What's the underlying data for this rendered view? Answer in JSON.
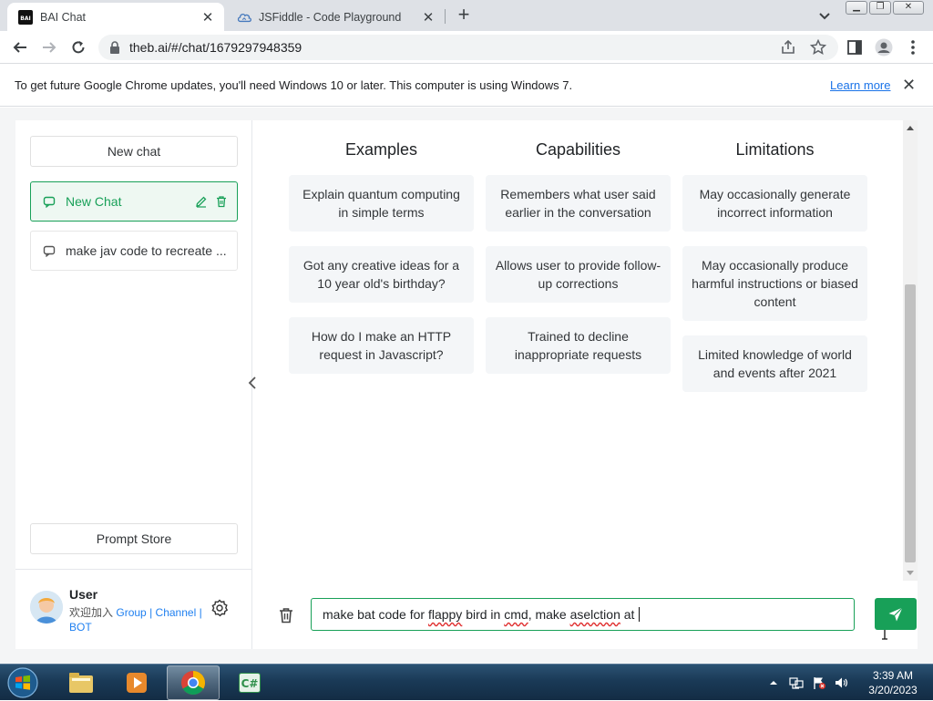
{
  "browser": {
    "tabs": [
      {
        "title": "BAI Chat",
        "favicon": "bai-logo"
      },
      {
        "title": "JSFiddle - Code Playground",
        "favicon": "jsfiddle-cloud-icon"
      }
    ],
    "url": "theb.ai/#/chat/1679297948359",
    "infobar": {
      "message": "To get future Google Chrome updates, you'll need Windows 10 or later. This computer is using Windows 7.",
      "link": "Learn more"
    }
  },
  "sidebar": {
    "new_chat_button": "New chat",
    "chats": [
      {
        "label": "New Chat",
        "active": true
      },
      {
        "label": "make jav code to recreate ...",
        "active": false
      }
    ],
    "prompt_store_button": "Prompt Store",
    "user": {
      "name": "User",
      "join_text": "欢迎加入",
      "links": [
        "Group",
        "Channel",
        "BOT"
      ],
      "separator": "|"
    }
  },
  "main": {
    "columns": [
      {
        "heading": "Examples",
        "cards": [
          "Explain quantum computing in simple terms",
          "Got any creative ideas for a 10 year old's birthday?",
          "How do I make an HTTP request in Javascript?"
        ]
      },
      {
        "heading": "Capabilities",
        "cards": [
          "Remembers what user said earlier in the conversation",
          "Allows user to provide follow-up corrections",
          "Trained to decline inappropriate requests"
        ]
      },
      {
        "heading": "Limitations",
        "cards": [
          "May occasionally generate incorrect information",
          "May occasionally produce harmful instructions or biased content",
          "Limited knowledge of world and events after 2021"
        ]
      }
    ],
    "input": {
      "parts": [
        "make bat code for ",
        "flappy",
        " bird in ",
        "cmd",
        ", make ",
        "aselction",
        " at "
      ]
    }
  },
  "taskbar": {
    "apps": [
      "windows-explorer",
      "media-player",
      "google-chrome",
      "csharp-app"
    ],
    "active_app": "google-chrome",
    "time": "3:39 AM",
    "date": "3/20/2023"
  },
  "colors": {
    "accent": "#18a058",
    "link": "#1a73e8",
    "taskbar": "#1a3a57"
  }
}
